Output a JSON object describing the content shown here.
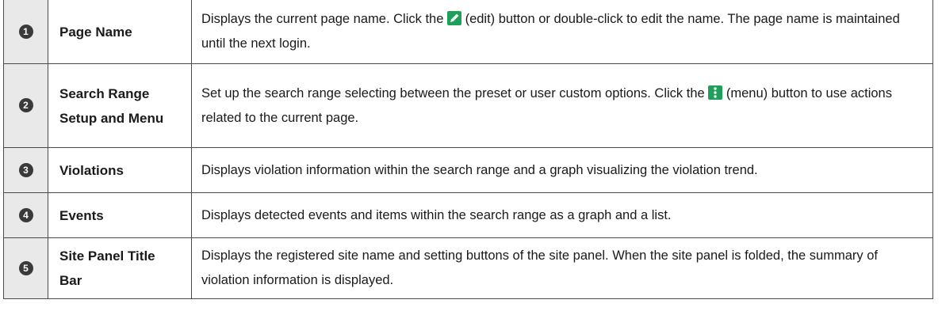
{
  "rows": [
    {
      "number": "1",
      "name": "Page Name",
      "text_before_icon": "Displays the current page name. Click the ",
      "icon": "edit-pencil-icon",
      "text_after_icon": " (edit) button or double-click to edit the name. The page name is maintained until the next login."
    },
    {
      "number": "2",
      "name": "Search Range Setup and Menu",
      "text_before_icon": "Set up the search range selecting between the preset or user custom options. Click the ",
      "icon": "menu-dots-icon",
      "text_after_icon": " (menu) button to use actions related to the current page."
    },
    {
      "number": "3",
      "name": "Violations",
      "text": "Displays violation information within the search range and a graph visualizing the violation trend."
    },
    {
      "number": "4",
      "name": "Events",
      "text": "Displays detected events and items within the search range as a graph and a list."
    },
    {
      "number": "5",
      "name": "Site Panel Title Bar",
      "text": "Displays the registered site name and setting buttons of the site panel. When the site panel is folded, the summary of violation information is displayed."
    }
  ],
  "colors": {
    "number_cell_bg": "#e9e9e9",
    "badge_bg": "#3a3a3a",
    "icon_bg": "#1ea05a",
    "border": "#4a4a4a"
  }
}
